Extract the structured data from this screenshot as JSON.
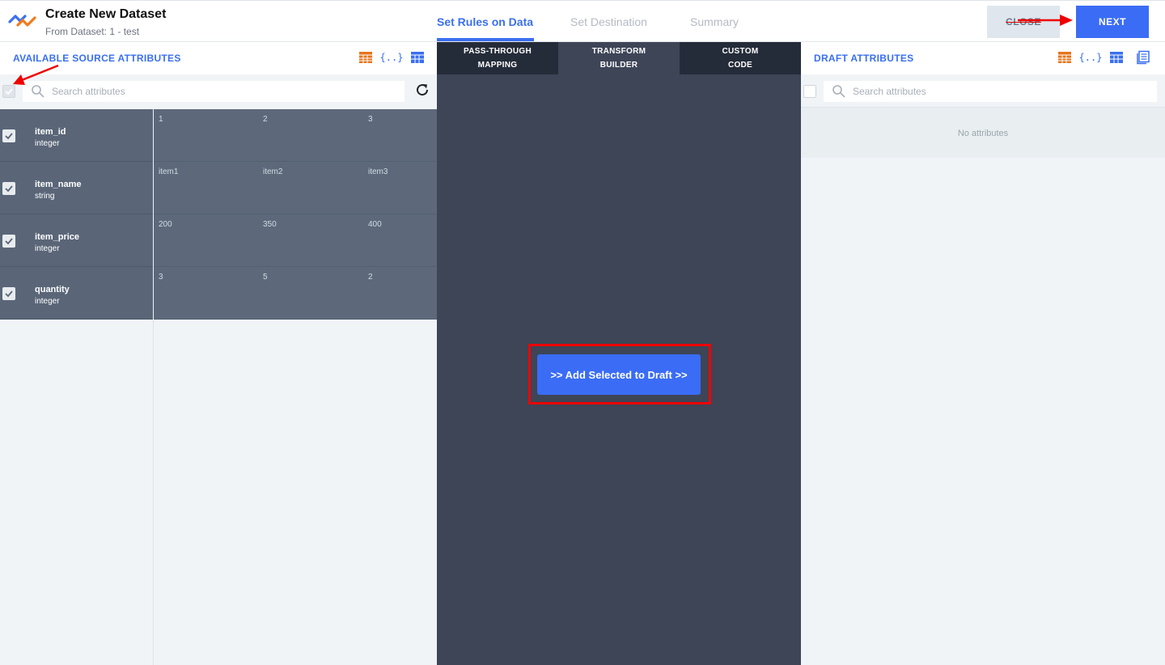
{
  "header": {
    "title": "Create New Dataset",
    "subtitle": "From Dataset: 1 - test",
    "steps": [
      {
        "label": "Set Rules on Data",
        "active": true
      },
      {
        "label": "Set Destination",
        "active": false
      },
      {
        "label": "Summary",
        "active": false
      }
    ],
    "close_label": "CLOSE",
    "next_label": "NEXT"
  },
  "left": {
    "title": "AVAILABLE SOURCE ATTRIBUTES",
    "search_placeholder": "Search attributes",
    "attributes": [
      {
        "name": "item_id",
        "type": "integer",
        "checked": true
      },
      {
        "name": "item_name",
        "type": "string",
        "checked": true
      },
      {
        "name": "item_price",
        "type": "integer",
        "checked": true
      },
      {
        "name": "quantity",
        "type": "integer",
        "checked": true
      }
    ],
    "preview": [
      [
        "1",
        "2",
        "3"
      ],
      [
        "item1",
        "item2",
        "item3"
      ],
      [
        "200",
        "350",
        "400"
      ],
      [
        "3",
        "5",
        "2"
      ]
    ]
  },
  "middle": {
    "tabs": [
      {
        "line1": "PASS-THROUGH",
        "line2": "MAPPING"
      },
      {
        "line1": "TRANSFORM",
        "line2": "BUILDER"
      },
      {
        "line1": "CUSTOM",
        "line2": "CODE"
      }
    ],
    "add_button_label": ">> Add Selected to Draft >>"
  },
  "right": {
    "title": "DRAFT ATTRIBUTES",
    "search_placeholder": "Search attributes",
    "empty_text": "No attributes"
  },
  "icons": {
    "json_icon_glyph": "{..}"
  },
  "colors": {
    "accent": "#3a6ff0",
    "orange_icon": "#e8741e",
    "annotation": "#e00000"
  }
}
